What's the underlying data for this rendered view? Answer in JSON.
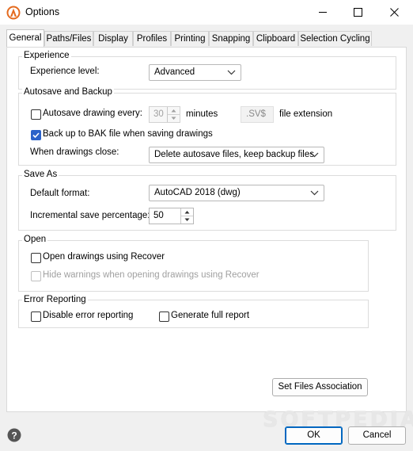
{
  "window": {
    "title": "Options",
    "minimize_icon": "minimize-icon",
    "maximize_icon": "maximize-icon",
    "close_icon": "close-icon"
  },
  "tabs": [
    {
      "label": "General",
      "active": true
    },
    {
      "label": "Paths/Files"
    },
    {
      "label": "Display"
    },
    {
      "label": "Profiles"
    },
    {
      "label": "Printing"
    },
    {
      "label": "Snapping"
    },
    {
      "label": "Clipboard"
    },
    {
      "label": "Selection Cycling"
    }
  ],
  "experience": {
    "group_title": "Experience",
    "level_label": "Experience level:",
    "level_value": "Advanced"
  },
  "autosave": {
    "group_title": "Autosave and Backup",
    "autosave_label": "Autosave drawing every:",
    "autosave_checked": false,
    "interval_value": "30",
    "minutes_label": "minutes",
    "extension_value": ".SV$",
    "extension_label": "file extension",
    "backup_label": "Back up to BAK file when saving drawings",
    "backup_checked": true,
    "close_label": "When drawings close:",
    "close_value": "Delete autosave files, keep backup files"
  },
  "save_as": {
    "group_title": "Save As",
    "format_label": "Default format:",
    "format_value": "AutoCAD 2018 (dwg)",
    "incremental_label": "Incremental save percentage:",
    "incremental_value": "50"
  },
  "open": {
    "group_title": "Open",
    "recover_label": "Open drawings using Recover",
    "recover_checked": false,
    "hide_warnings_label": "Hide warnings when opening drawings using Recover",
    "hide_warnings_checked": false
  },
  "error_reporting": {
    "group_title": "Error Reporting",
    "disable_label": "Disable error reporting",
    "disable_checked": false,
    "full_report_label": "Generate full report",
    "full_report_checked": false
  },
  "buttons": {
    "set_files_association": "Set Files Association",
    "ok": "OK",
    "cancel": "Cancel"
  },
  "watermark": "SOFTPEDIA",
  "colors": {
    "accent": "#2b62c9",
    "default_button_border": "#0067c0",
    "app_icon_orange": "#e46a1e"
  }
}
